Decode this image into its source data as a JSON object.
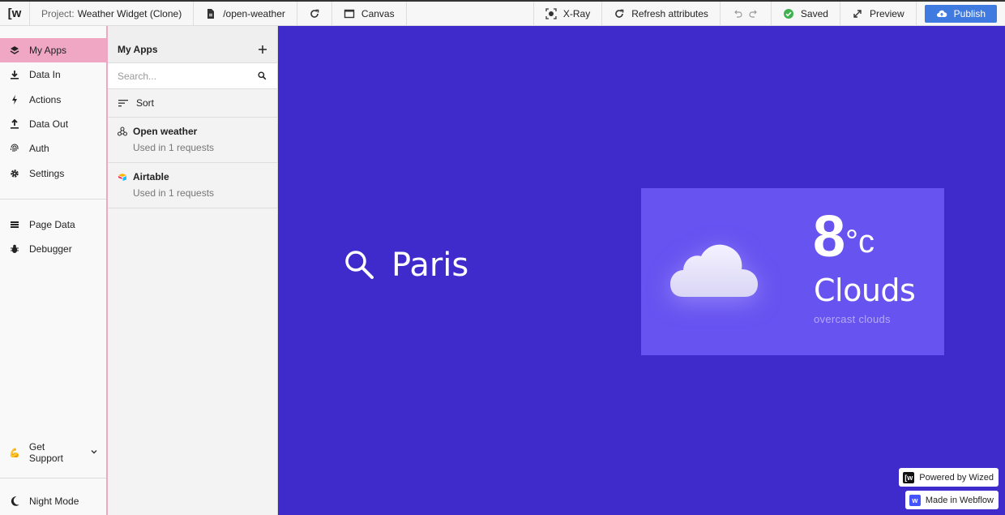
{
  "topbar": {
    "logo": "[w",
    "project_label": "Project:",
    "project_name": "Weather Widget (Clone)",
    "page_path": "/open-weather",
    "canvas_label": "Canvas",
    "xray_label": "X-Ray",
    "refresh_attributes_label": "Refresh attributes",
    "saved_label": "Saved",
    "preview_label": "Preview",
    "publish_label": "Publish"
  },
  "sidebar": {
    "items": [
      {
        "label": "My Apps",
        "icon": "layers-icon",
        "active": true
      },
      {
        "label": "Data In",
        "icon": "download-icon"
      },
      {
        "label": "Actions",
        "icon": "bolt-icon"
      },
      {
        "label": "Data Out",
        "icon": "upload-icon"
      },
      {
        "label": "Auth",
        "icon": "fingerprint-icon"
      },
      {
        "label": "Settings",
        "icon": "gear-icon"
      }
    ],
    "secondary": [
      {
        "label": "Page Data",
        "icon": "list-icon"
      },
      {
        "label": "Debugger",
        "icon": "bug-icon"
      }
    ],
    "support_label": "Get Support",
    "night_mode_label": "Night Mode"
  },
  "apps_panel": {
    "title": "My Apps",
    "search_placeholder": "Search...",
    "search_value": "",
    "sort_label": "Sort",
    "apps": [
      {
        "name": "Open weather",
        "usage": "Used in 1 requests",
        "icon": "webhook-icon"
      },
      {
        "name": "Airtable",
        "usage": "Used in 1 requests",
        "icon": "airtable-icon"
      }
    ]
  },
  "canvas": {
    "city": "Paris",
    "temperature": "8",
    "unit": "°c",
    "condition": "Clouds",
    "description": "overcast clouds",
    "badges": {
      "wized": "Powered by Wized",
      "webflow": "Made in Webflow"
    }
  },
  "colors": {
    "canvas_bg": "#3f2bcc",
    "card_bg": "#6753f0",
    "active_nav": "#f0a7c3",
    "publish": "#3f7ae0",
    "saved_check": "#3fb24f"
  }
}
